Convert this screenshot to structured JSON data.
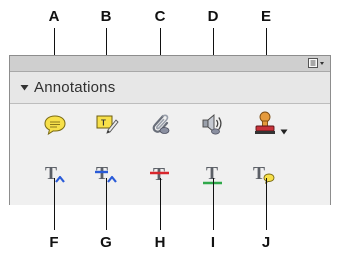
{
  "callouts_top": [
    "A",
    "B",
    "C",
    "D",
    "E"
  ],
  "callouts_bottom": [
    "F",
    "G",
    "H",
    "I",
    "J"
  ],
  "panel": {
    "title": "Annotations",
    "menu_icon": "panel-options-icon",
    "toggle_icon": "collapse-triangle-icon"
  },
  "tools_row1": [
    {
      "icon": "sticky-note-icon"
    },
    {
      "icon": "text-edits-icon"
    },
    {
      "icon": "attach-file-icon"
    },
    {
      "icon": "record-audio-icon"
    },
    {
      "icon": "stamp-icon",
      "has_dropdown": true
    }
  ],
  "tools_row2": [
    {
      "icon": "insert-text-icon"
    },
    {
      "icon": "replace-text-icon"
    },
    {
      "icon": "strikethrough-text-icon"
    },
    {
      "icon": "underline-text-icon"
    },
    {
      "icon": "add-note-to-text-icon"
    }
  ],
  "colors": {
    "note_yellow": "#f7e04a",
    "blue_caret": "#2a5bd8",
    "strike_red": "#d8262c",
    "underline_green": "#2fa84a",
    "panel_bg": "#f0f0f0",
    "header_bg": "#e7e7e7"
  }
}
